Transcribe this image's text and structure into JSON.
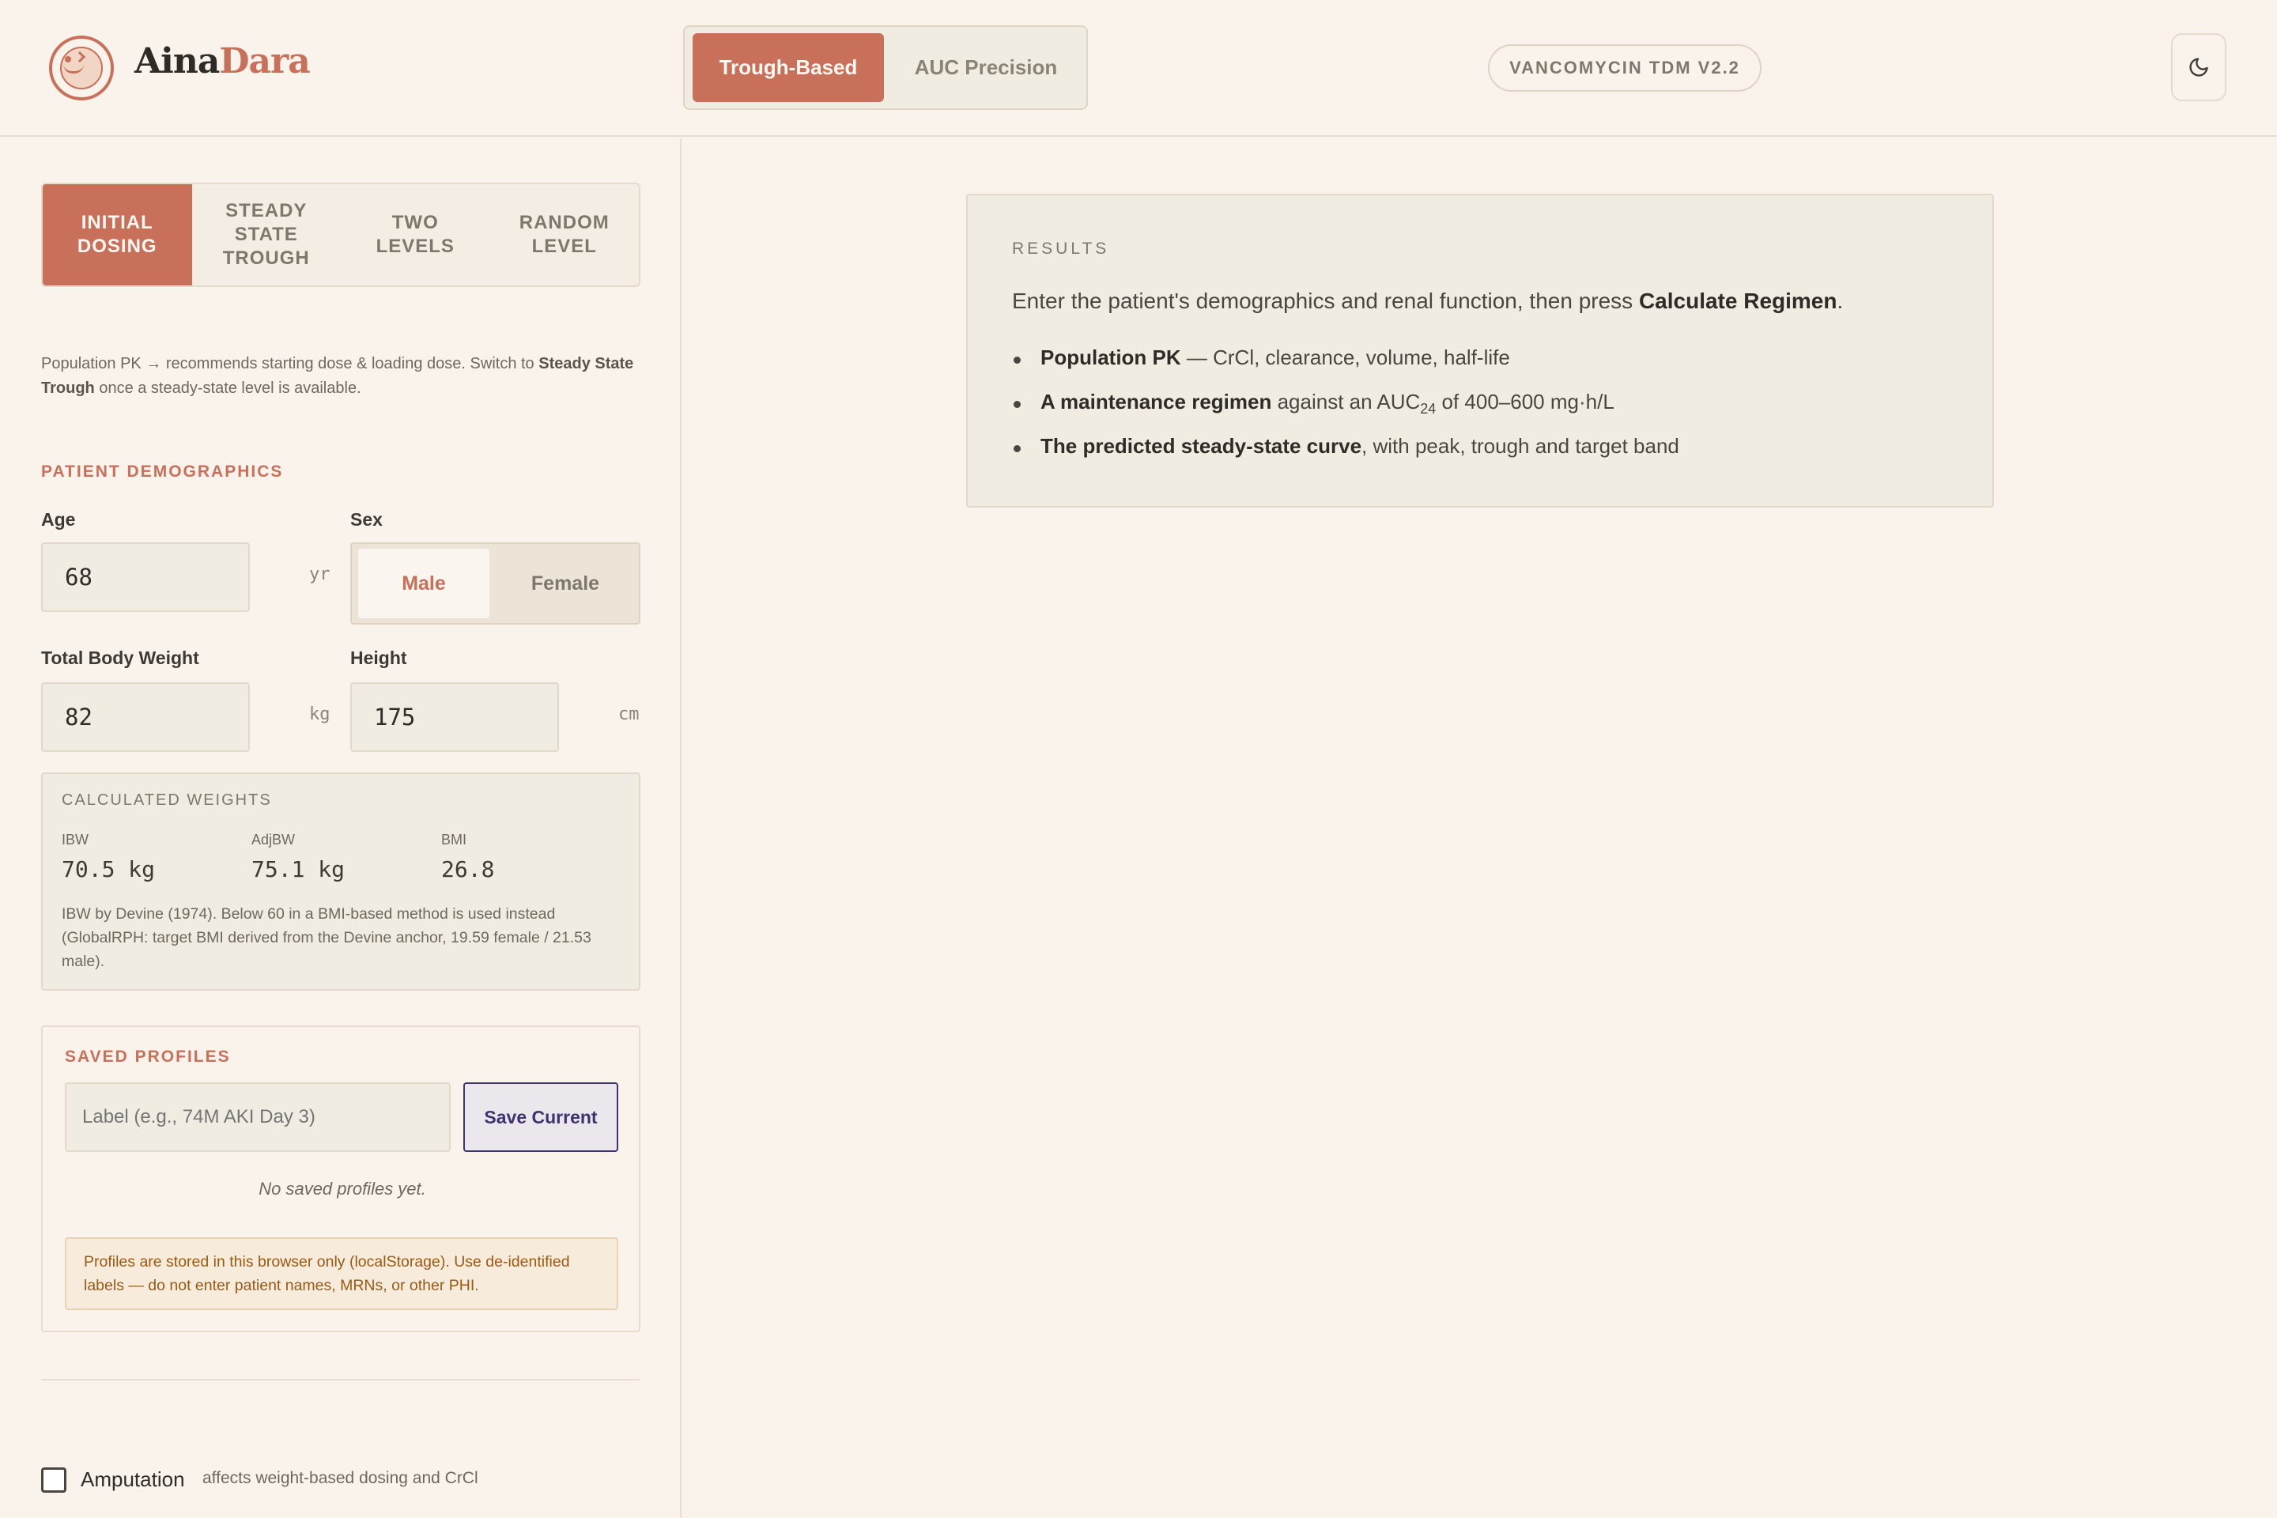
{
  "brand": {
    "part1": "Aina",
    "part2": "Dara"
  },
  "modes": {
    "active": "Trough-Based",
    "other": "AUC Precision"
  },
  "version": "VANCOMYCIN TDM V2.2",
  "tabs": [
    {
      "label": "INITIAL\nDOSING",
      "active": true
    },
    {
      "label": "STEADY\nSTATE\nTROUGH",
      "active": false
    },
    {
      "label": "TWO\nLEVELS",
      "active": false
    },
    {
      "label": "RANDOM\nLEVEL",
      "active": false
    }
  ],
  "info": {
    "text1": "Population PK → recommends starting dose & loading dose. Switch to ",
    "bold": "Steady State Trough",
    "text2": " once a steady-state level is available."
  },
  "demographics": {
    "section_title": "PATIENT DEMOGRAPHICS",
    "age_label": "Age",
    "age_value": "68",
    "age_unit": "yr",
    "sex_label": "Sex",
    "sex_options": [
      "Male",
      "Female"
    ],
    "sex_selected": "Male",
    "weight_label": "Total Body Weight",
    "weight_value": "82",
    "weight_unit": "kg",
    "height_label": "Height",
    "height_value": "175",
    "height_unit": "cm"
  },
  "calculated": {
    "title": "CALCULATED WEIGHTS",
    "ibw_label": "IBW",
    "ibw_value": "70.5 kg",
    "adjbw_label": "AdjBW",
    "adjbw_value": "75.1 kg",
    "bmi_label": "BMI",
    "bmi_value": "26.8",
    "note": "IBW by Devine (1974). Below 60 in a BMI-based method is used instead (GlobalRPH: target BMI derived from the Devine anchor, 19.59 female / 21.53 male)."
  },
  "saved_profiles": {
    "title": "SAVED PROFILES",
    "input_placeholder": "Label (e.g., 74M AKI Day 3)",
    "save_label": "Save Current",
    "empty_text": "No saved profiles yet.",
    "warning": "Profiles are stored in this browser only (localStorage). Use de-identified labels — do not enter patient names, MRNs, or other PHI."
  },
  "amputation": {
    "label": "Amputation",
    "hint": "affects weight-based dosing and CrCl",
    "checked": false
  },
  "results": {
    "title": "RESULTS",
    "lead_text": "Enter the patient's demographics and renal function, then press ",
    "lead_bold": "Calculate Regimen",
    "lead_end": ".",
    "items": [
      {
        "bold": "Population PK",
        "text": " — CrCl, clearance, volume, half-life"
      },
      {
        "bold": "A maintenance regimen",
        "text_a": " against an AUC",
        "sub": "24",
        "text_b": " of 400–600 mg·h/L"
      },
      {
        "bold": "The predicted steady-state curve",
        "text": ", with peak, trough and target band"
      }
    ]
  },
  "colors": {
    "accent": "#c9705a",
    "background": "#faf3ec",
    "panel": "#f1ece1",
    "save_border": "#3d3470"
  }
}
